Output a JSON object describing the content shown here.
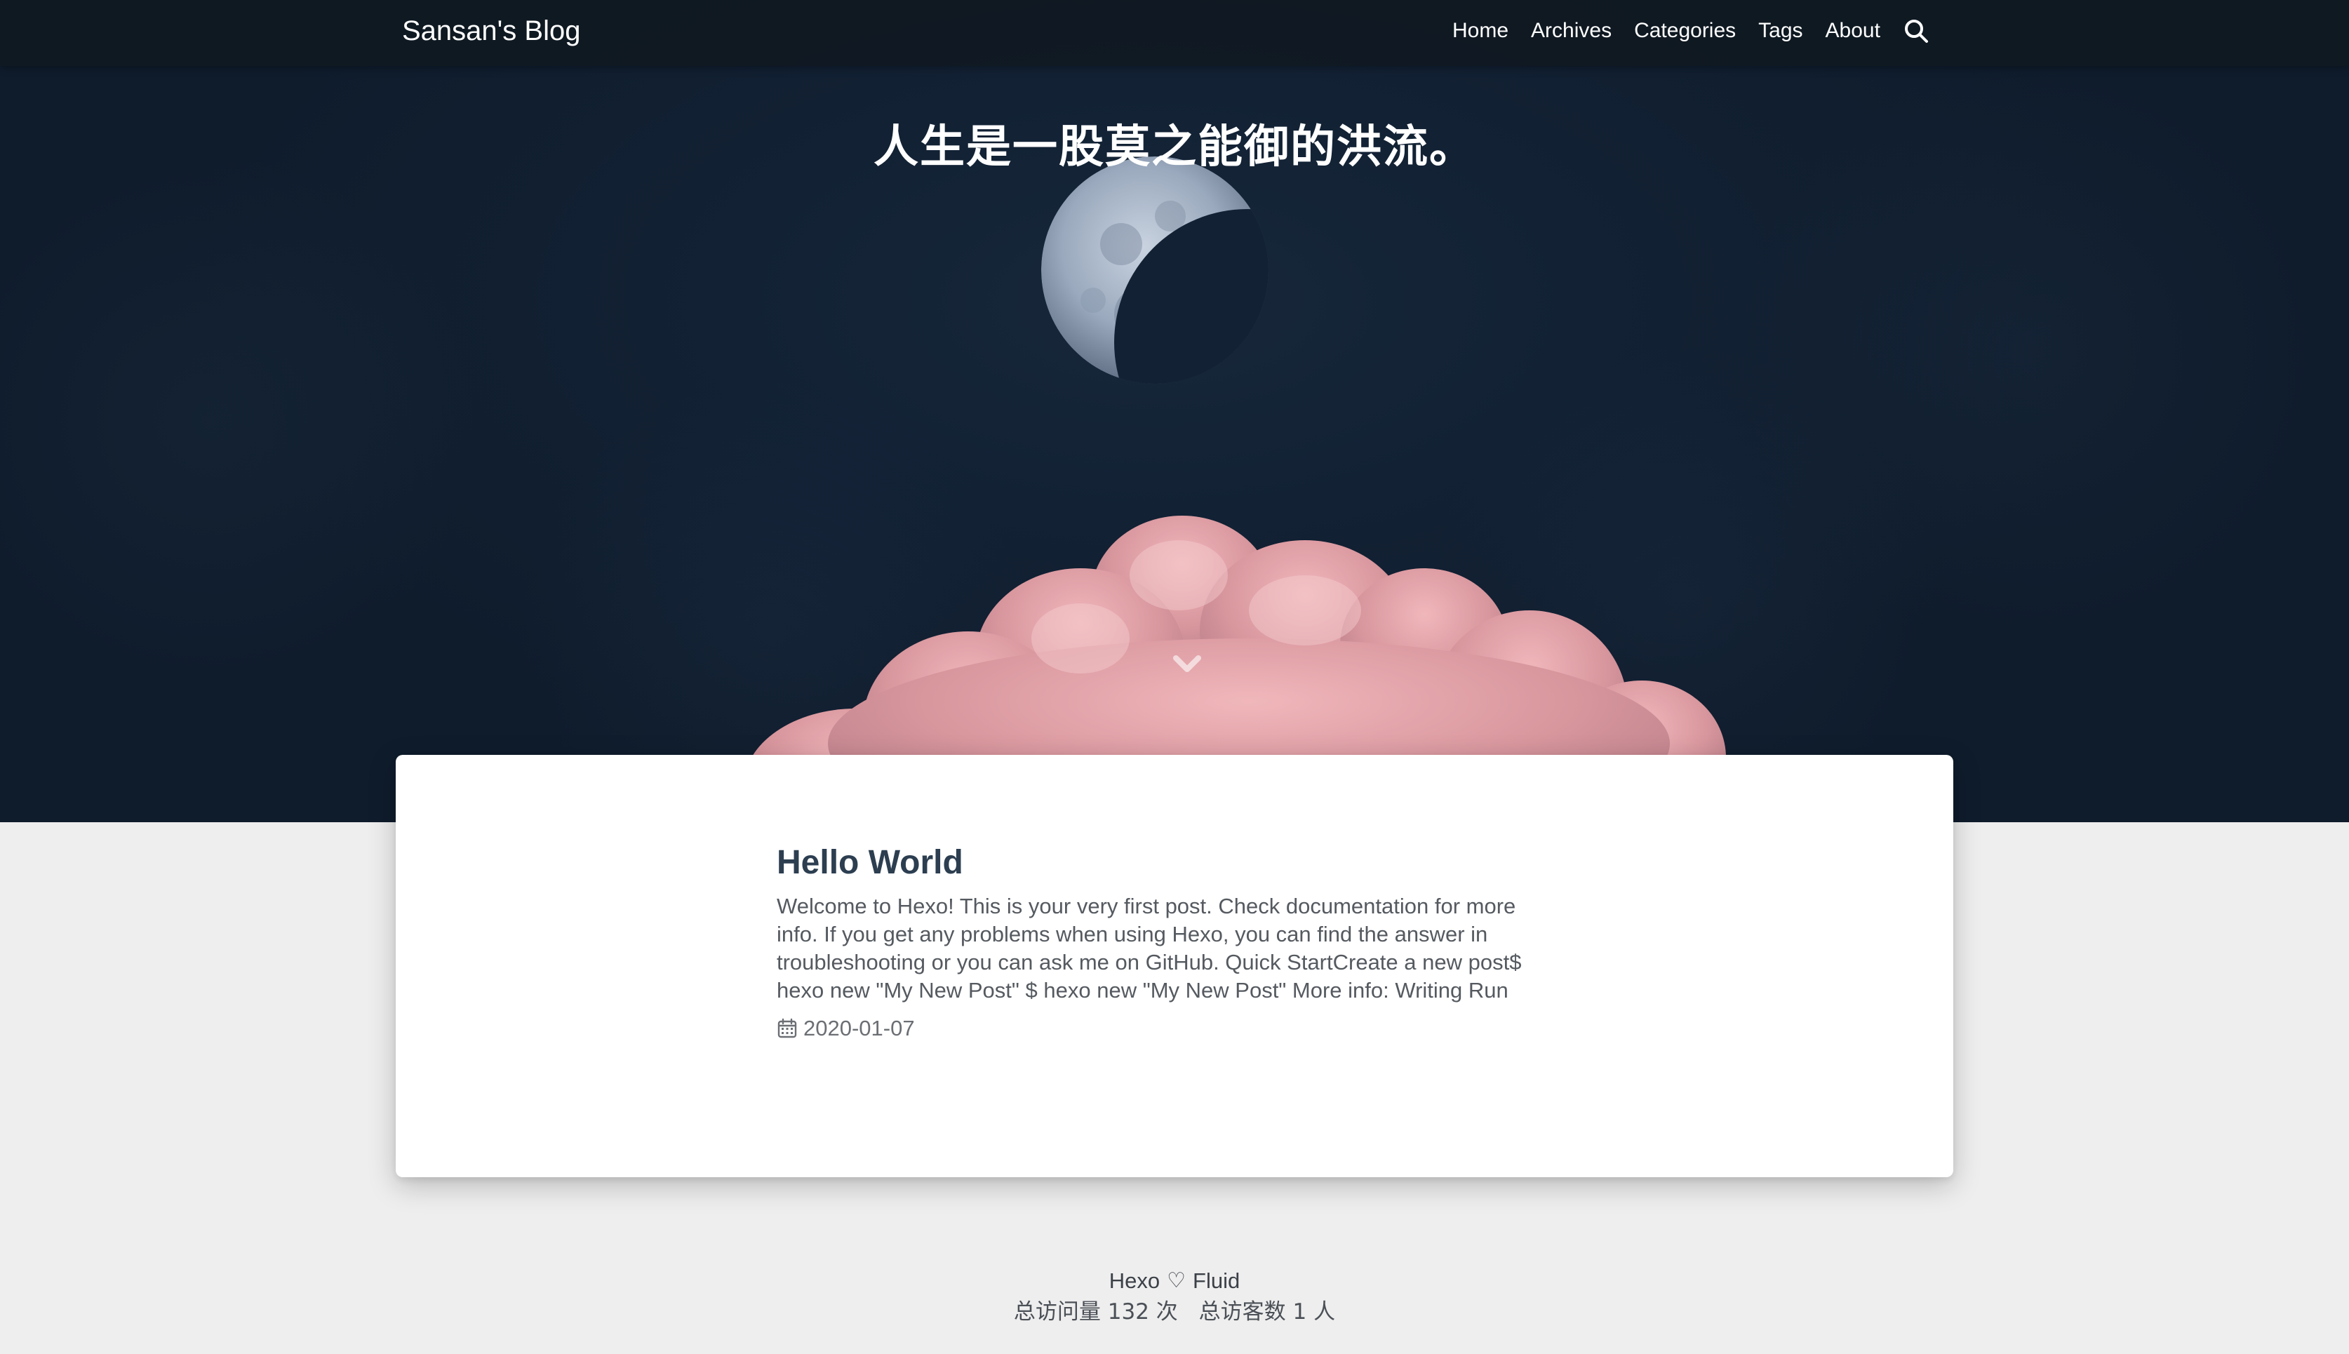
{
  "navbar": {
    "brand": "Sansan's Blog",
    "items": [
      {
        "label": "Home"
      },
      {
        "label": "Archives"
      },
      {
        "label": "Categories"
      },
      {
        "label": "Tags"
      },
      {
        "label": "About"
      }
    ],
    "search_icon": "search-icon"
  },
  "hero": {
    "slogan": "人生是一股莫之能御的洪流。",
    "scroll_icon": "chevron-down-icon"
  },
  "post": {
    "title": "Hello World",
    "excerpt": "Welcome to Hexo! This is your very first post. Check documentation for more info. If you get any problems when using Hexo, you can find the answer in troubleshooting or you can ask me on GitHub. Quick StartCreate a new post$ hexo new \"My New Post\" $ hexo new \"My New Post\" More info: Writing Run",
    "date": "2020-01-07",
    "date_icon": "calendar-icon"
  },
  "footer": {
    "hexo": "Hexo",
    "fluid": "Fluid",
    "heart": "♡",
    "total_views": "总访问量 132 次",
    "total_visitors": "总访客数 1 人"
  },
  "colors": {
    "hero_bg": "#122134",
    "cloud": "#d8969d",
    "page_bg": "#eeeeee",
    "title": "#2c3e50"
  }
}
